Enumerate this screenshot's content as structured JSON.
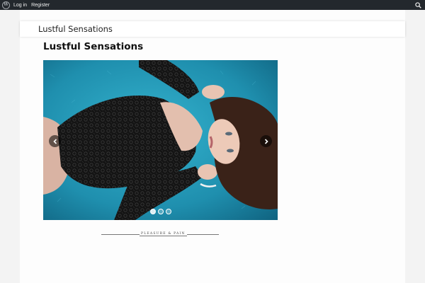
{
  "adminbar": {
    "login_label": "Log in",
    "register_label": "Register"
  },
  "header": {
    "site_title": "Lustful Sensations"
  },
  "post": {
    "title": "Lustful Sensations",
    "category": "PLEASURE & PAIN"
  },
  "slider": {
    "slide_count": 3,
    "active_index": 0
  },
  "colors": {
    "adminbar_bg": "#23282d",
    "carpet": "#2aa0bd",
    "lace": "#1a1a1a",
    "hair": "#3a2218",
    "skin": "#e8c4b2"
  }
}
